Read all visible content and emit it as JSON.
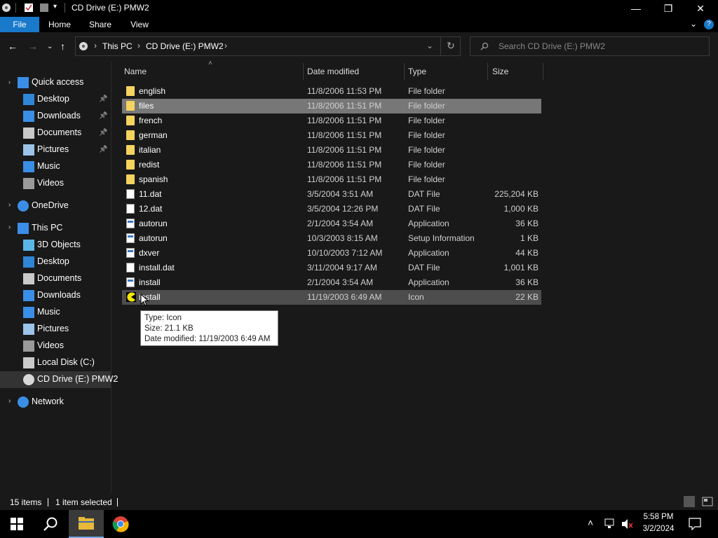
{
  "window": {
    "title": "CD Drive (E:) PMW2",
    "minimize": "—",
    "maximize": "❐",
    "close": "✕"
  },
  "ribbon": {
    "tabs": [
      "File",
      "Home",
      "Share",
      "View"
    ],
    "help_icon": "?"
  },
  "address": {
    "breadcrumbs": [
      "This PC",
      "CD Drive (E:) PMW2"
    ],
    "search_placeholder": "Search CD Drive (E:) PMW2"
  },
  "sidebar": {
    "items": [
      {
        "label": "Quick access",
        "icon": "star-icon"
      },
      {
        "label": "Desktop",
        "icon": "desktop-icon",
        "pinned": true
      },
      {
        "label": "Downloads",
        "icon": "download-icon",
        "pinned": true
      },
      {
        "label": "Documents",
        "icon": "documents-icon",
        "pinned": true
      },
      {
        "label": "Pictures",
        "icon": "pictures-icon",
        "pinned": true
      },
      {
        "label": "Music",
        "icon": "music-icon"
      },
      {
        "label": "Videos",
        "icon": "videos-icon"
      },
      {
        "label": "OneDrive",
        "icon": "cloud-icon"
      },
      {
        "label": "This PC",
        "icon": "computer-icon"
      },
      {
        "label": "3D Objects",
        "icon": "cube-icon"
      },
      {
        "label": "Desktop",
        "icon": "desktop-icon"
      },
      {
        "label": "Documents",
        "icon": "documents-icon"
      },
      {
        "label": "Downloads",
        "icon": "download-icon"
      },
      {
        "label": "Music",
        "icon": "music-icon"
      },
      {
        "label": "Pictures",
        "icon": "pictures-icon"
      },
      {
        "label": "Videos",
        "icon": "videos-icon"
      },
      {
        "label": "Local Disk (C:)",
        "icon": "disk-icon"
      },
      {
        "label": "CD Drive (E:) PMW2",
        "icon": "cd-icon",
        "selected": true
      },
      {
        "label": "Network",
        "icon": "network-icon"
      }
    ]
  },
  "columns": {
    "name": "Name",
    "date": "Date modified",
    "type": "Type",
    "size": "Size"
  },
  "files": [
    {
      "name": "english",
      "date": "11/8/2006 11:53 PM",
      "type": "File folder",
      "size": "",
      "icon": "folder-icon"
    },
    {
      "name": "files",
      "date": "11/8/2006 11:51 PM",
      "type": "File folder",
      "size": "",
      "icon": "folder-icon",
      "selected": true
    },
    {
      "name": "french",
      "date": "11/8/2006 11:51 PM",
      "type": "File folder",
      "size": "",
      "icon": "folder-icon"
    },
    {
      "name": "german",
      "date": "11/8/2006 11:51 PM",
      "type": "File folder",
      "size": "",
      "icon": "folder-icon"
    },
    {
      "name": "italian",
      "date": "11/8/2006 11:51 PM",
      "type": "File folder",
      "size": "",
      "icon": "folder-icon"
    },
    {
      "name": "redist",
      "date": "11/8/2006 11:51 PM",
      "type": "File folder",
      "size": "",
      "icon": "folder-icon"
    },
    {
      "name": "spanish",
      "date": "11/8/2006 11:51 PM",
      "type": "File folder",
      "size": "",
      "icon": "folder-icon"
    },
    {
      "name": "11.dat",
      "date": "3/5/2004 3:51 AM",
      "type": "DAT File",
      "size": "225,204 KB",
      "icon": "file-icon"
    },
    {
      "name": "12.dat",
      "date": "3/5/2004 12:26 PM",
      "type": "DAT File",
      "size": "1,000 KB",
      "icon": "file-icon"
    },
    {
      "name": "autorun",
      "date": "2/1/2004 3:54 AM",
      "type": "Application",
      "size": "36 KB",
      "icon": "application-icon"
    },
    {
      "name": "autorun",
      "date": "10/3/2003 8:15 AM",
      "type": "Setup Information",
      "size": "1 KB",
      "icon": "settings-file-icon"
    },
    {
      "name": "dxver",
      "date": "10/10/2003 7:12 AM",
      "type": "Application",
      "size": "44 KB",
      "icon": "application-icon"
    },
    {
      "name": "install.dat",
      "date": "3/11/2004 9:17 AM",
      "type": "DAT File",
      "size": "1,001 KB",
      "icon": "file-icon"
    },
    {
      "name": "install",
      "date": "2/1/2004 3:54 AM",
      "type": "Application",
      "size": "36 KB",
      "icon": "application-icon"
    },
    {
      "name": "install",
      "date": "11/19/2003 6:49 AM",
      "type": "Icon",
      "size": "22 KB",
      "icon": "pacman-icon",
      "hovered": true
    }
  ],
  "tooltip": {
    "type": "Type: Icon",
    "size": "Size: 21.1 KB",
    "date": "Date modified: 11/19/2003 6:49 AM"
  },
  "status": {
    "count": "15 items",
    "selected": "1 item selected"
  },
  "taskbar": {
    "time": "5:58 PM",
    "date": "3/2/2024"
  }
}
